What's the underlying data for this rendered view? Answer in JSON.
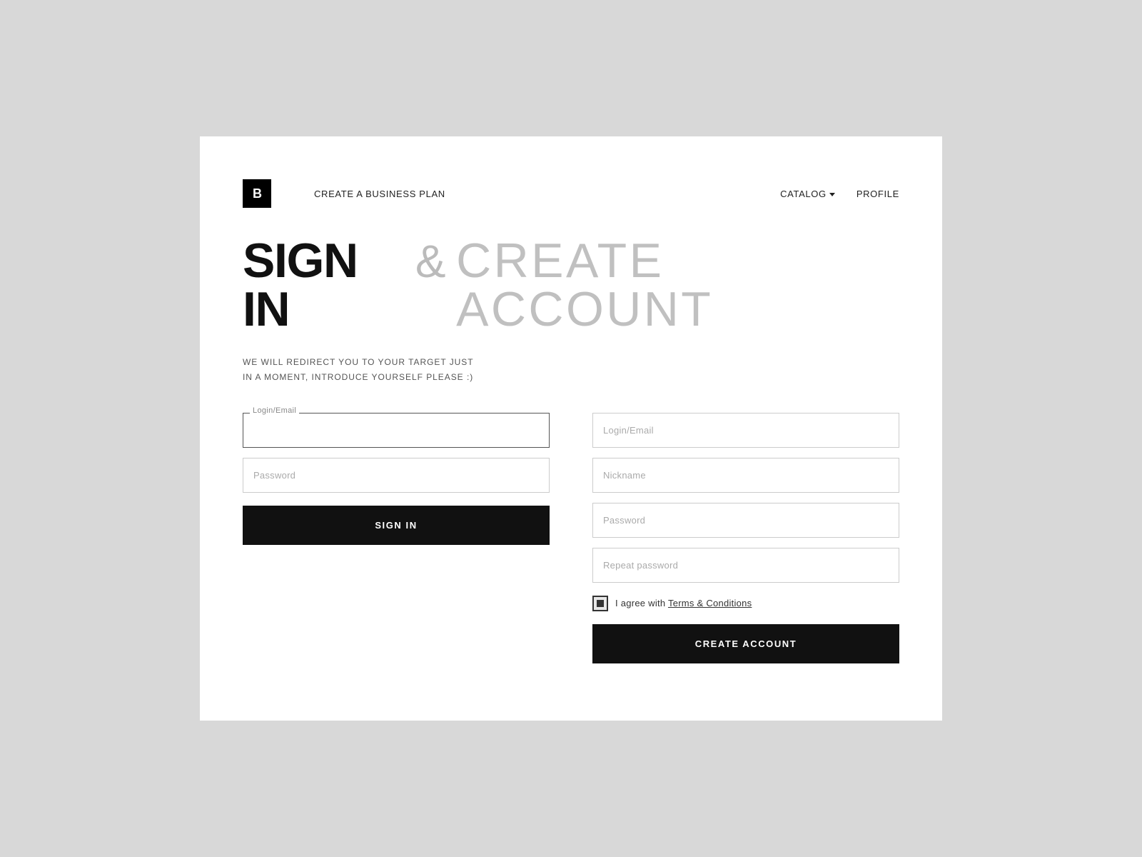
{
  "logo": {
    "text": "B"
  },
  "nav": {
    "create_business_plan": "CREATE A BUSINESS PLAN",
    "catalog": "CATALOG",
    "profile": "PROFILE"
  },
  "page": {
    "title_signin": "SIGN IN",
    "title_ampersand": "&",
    "title_create": "CREATE ACCOUNT",
    "subtitle_line1": "WE WILL REDIRECT YOU TO YOUR TARGET JUST",
    "subtitle_line2": "IN A MOMENT, INTRODUCE YOURSELF PLEASE :)"
  },
  "signin_form": {
    "email_label": "Login/Email",
    "email_placeholder": "",
    "password_placeholder": "Password",
    "button_label": "SIGN IN"
  },
  "create_form": {
    "email_placeholder": "Login/Email",
    "nickname_placeholder": "Nickname",
    "password_placeholder": "Password",
    "repeat_password_placeholder": "Repeat password",
    "terms_prefix": "I agree with ",
    "terms_link": "Terms & Conditions",
    "button_label": "CREATE ACCOUNT"
  }
}
